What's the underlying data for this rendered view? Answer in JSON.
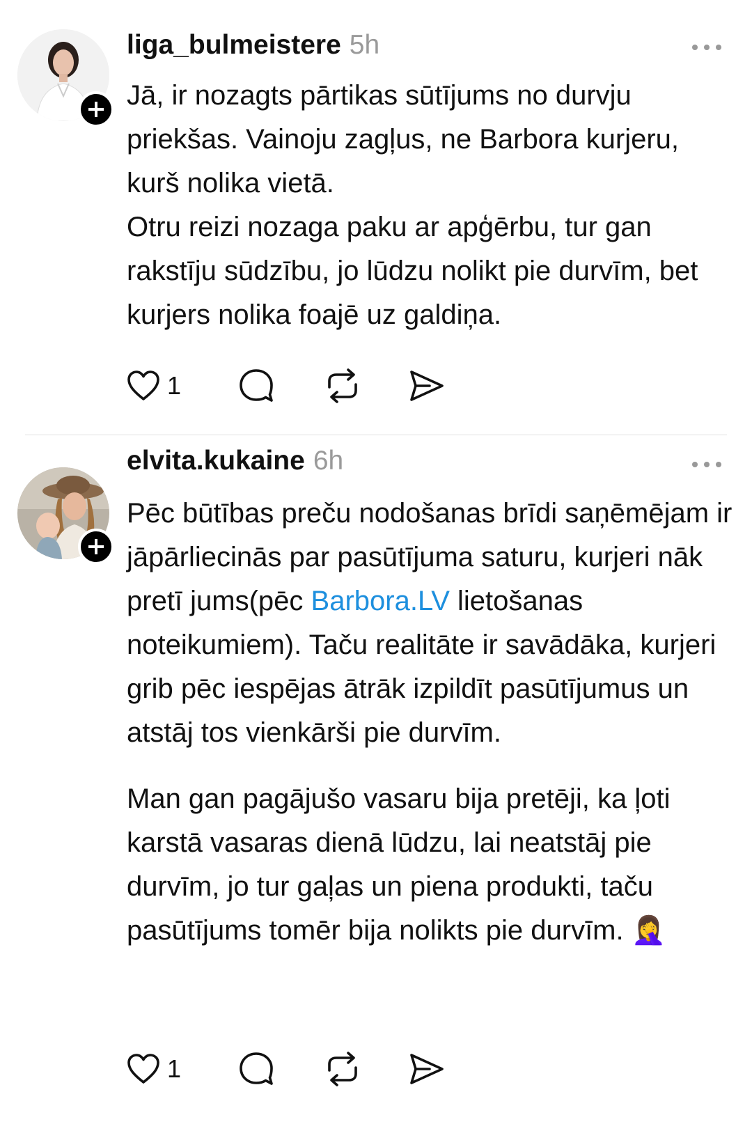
{
  "colors": {
    "background": "#ffffff",
    "text": "#111111",
    "muted": "#9a9a9a",
    "link": "#1d8fde",
    "divider": "#e2e2e2"
  },
  "posts": [
    {
      "username": "liga_bulmeistere",
      "time": "5h",
      "paragraphs": [
        "Jā, ir nozagts pārtikas sūtījums no durvju priekšas. Vainoju zagļus, ne Barbora kurjeru, kurš nolika vietā.",
        "Otru reizi nozaga paku ar apģērbu, tur gan rakstīju sūdzību, jo lūdzu nolikt pie durvīm, bet kurjers nolika foajē uz galdiņa."
      ],
      "like_count": "1",
      "icons": [
        "heart-icon",
        "comment-icon",
        "repost-icon",
        "share-icon",
        "more-icon",
        "plus-icon"
      ]
    },
    {
      "username": "elvita.kukaine",
      "time": "6h",
      "paragraph_1_before_link": "Pēc būtības preču nodošanas brīdi saņēmējam ir jāpārliecinās par pasūtījuma saturu, kurjeri nāk pretī jums(pēc ",
      "link_text": "Barbora.LV",
      "paragraph_1_after_link": " lietošanas noteikumiem). Taču realitāte ir savādāka, kurjeri grib pēc iespējas ātrāk izpildīt pasūtījumus un atstāj tos vienkārši pie durvīm.",
      "paragraph_2": "Man gan pagājušo vasaru bija pretēji, ka ļoti karstā vasaras dienā lūdzu, lai neatstāj pie durvīm, jo tur gaļas un piena produkti, taču pasūtījums tomēr bija nolikts pie durvīm.",
      "emoji": "🤦‍♀️",
      "like_count": "1",
      "icons": [
        "heart-icon",
        "comment-icon",
        "repost-icon",
        "share-icon",
        "more-icon",
        "plus-icon",
        "facepalm-emoji"
      ]
    }
  ]
}
